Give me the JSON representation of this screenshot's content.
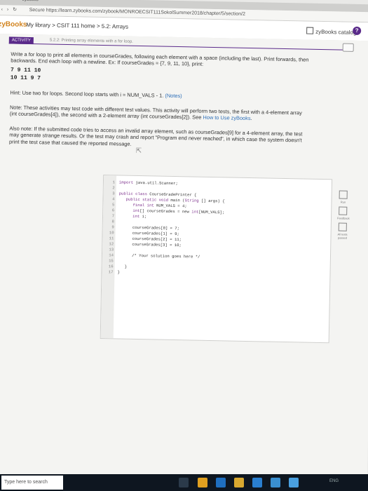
{
  "browser": {
    "tab_title": "zyBooks",
    "secure_label": "Secure",
    "url": "https://learn.zybooks.com/zybook/MONROECSIT111SokolSummer2018/chapter/5/section/2"
  },
  "header": {
    "logo": "zyBooks",
    "breadcrumb": "My library > CSIT 111 home > 5.2: Arrays",
    "catalog_label": "zyBooks catalog",
    "help_label": "?"
  },
  "activity": {
    "tag": "ACTIVITY",
    "title_partial": "5.2.2: Printing array elements with a for loop.",
    "prompt_line1": "Write a for loop to print all elements in courseGrades, following each element with a space (including the last). Print forwards, then",
    "prompt_line2": "backwards. End each loop with a newline. Ex: If courseGrades = {7, 9, 11, 10}, print:",
    "example_output": [
      "7 9 11 10",
      "10 11 9 7"
    ],
    "hint_text": "Hint: Use two for loops. Second loop starts with i = NUM_VALS - 1.",
    "hint_link": "(Notes)",
    "note_line1": "Note: These activities may test code with different test values. This activity will perform two tests, the first with a 4-element array",
    "note_line2": "(int courseGrades[4]), the second with a 2-element array (int courseGrades[2]). See",
    "note_link": "How to Use zyBooks",
    "note_line2_end": ".",
    "also_line1": "Also note: If the submitted code tries to access an invalid array element, such as courseGrades[9] for a 4-element array, the test",
    "also_line2": "may generate strange results. Or the test may crash and report \"Program end never reached\", in which case the system doesn't",
    "also_line3": "print the test case that caused the reported message."
  },
  "editor": {
    "line_numbers": [
      "1",
      "2",
      "3",
      "4",
      "5",
      "6",
      "7",
      "8",
      "9",
      "10",
      "11",
      "12",
      "13",
      "14",
      "15",
      "16",
      "17"
    ],
    "lines": [
      "import java.util.Scanner;",
      "",
      "public class CourseGradePrinter {",
      "   public static void main (String [] args) {",
      "      final int NUM_VALS = 4;",
      "      int[] courseGrades = new int[NUM_VALS];",
      "      int i;",
      "",
      "      courseGrades[0] = 7;",
      "      courseGrades[1] = 9;",
      "      courseGrades[2] = 11;",
      "      courseGrades[3] = 10;",
      "",
      "      /* Your solution goes here */",
      "",
      "   }",
      "}"
    ]
  },
  "side_panel": {
    "items": [
      "Run",
      "Feedback",
      "All tests passed"
    ]
  },
  "taskbar": {
    "search_placeholder": "Type here to search",
    "tray": "ENG"
  },
  "colors": {
    "accent": "#5a2a8a",
    "logo": "#d2841f",
    "link": "#2e6fb8"
  }
}
